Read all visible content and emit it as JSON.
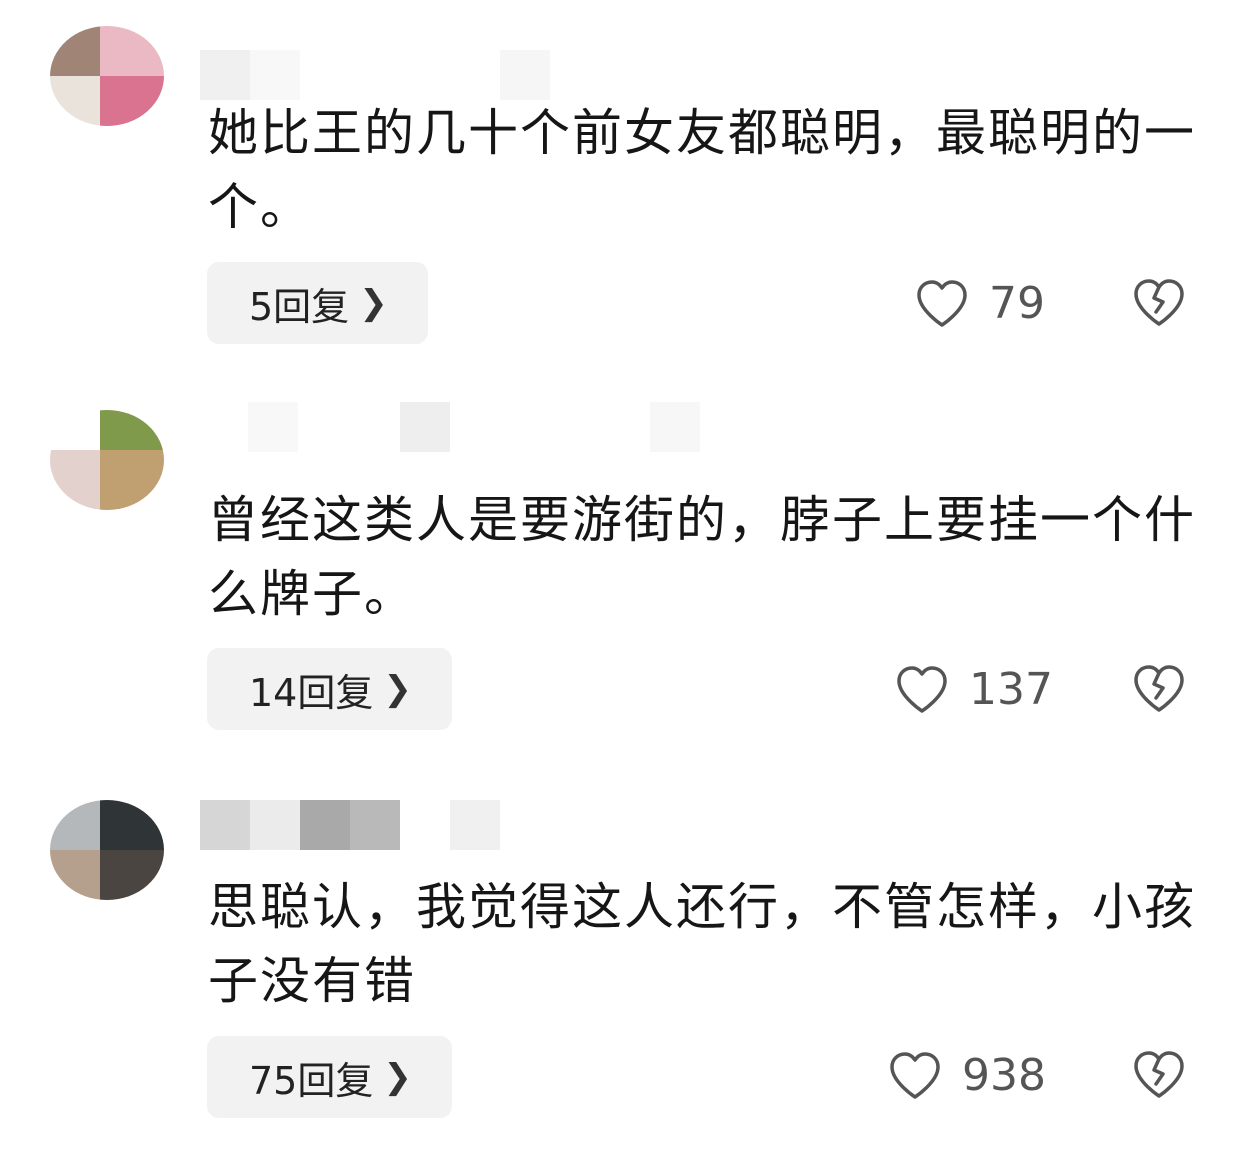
{
  "comments": [
    {
      "text": "她比王的几十个前女友都聪明，最聪明的一个。",
      "reply_label": "5回复",
      "likes": "79"
    },
    {
      "text": "曾经这类人是要游街的，脖子上要挂一个什么牌子。",
      "reply_label": "14回复",
      "likes": "137"
    },
    {
      "text": "思聪认，我觉得这人还行，不管怎样，小孩子没有错",
      "reply_label": "75回复",
      "likes": "938"
    }
  ],
  "icons": {
    "reply_chevron": "chevron-right-icon",
    "like": "heart-icon",
    "dislike": "broken-heart-icon"
  },
  "colors": {
    "reply_bg": "#f2f2f2",
    "text": "#161616",
    "icon": "#555555"
  }
}
